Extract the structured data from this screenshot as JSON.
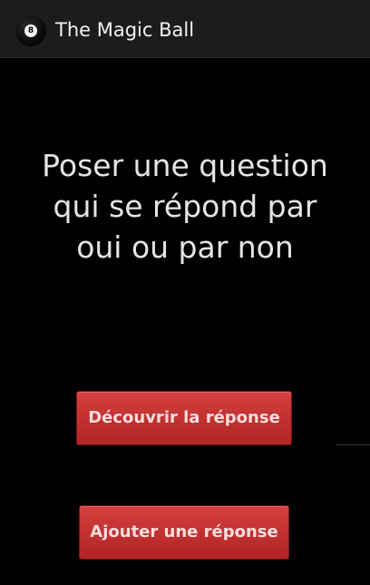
{
  "action_bar": {
    "title": "The Magic Ball",
    "icon": "eight-ball-icon",
    "icon_glyph": "8"
  },
  "main": {
    "prompt": "Poser une question qui se répond par oui ou par non"
  },
  "buttons": {
    "discover_label": "Découvrir la réponse",
    "add_label": "Ajouter une réponse"
  },
  "colors": {
    "background": "#000000",
    "action_bar": "#1c1c1c",
    "button": "#c33131",
    "button_text": "#f7dede",
    "prompt_text": "#e4e4e4"
  }
}
